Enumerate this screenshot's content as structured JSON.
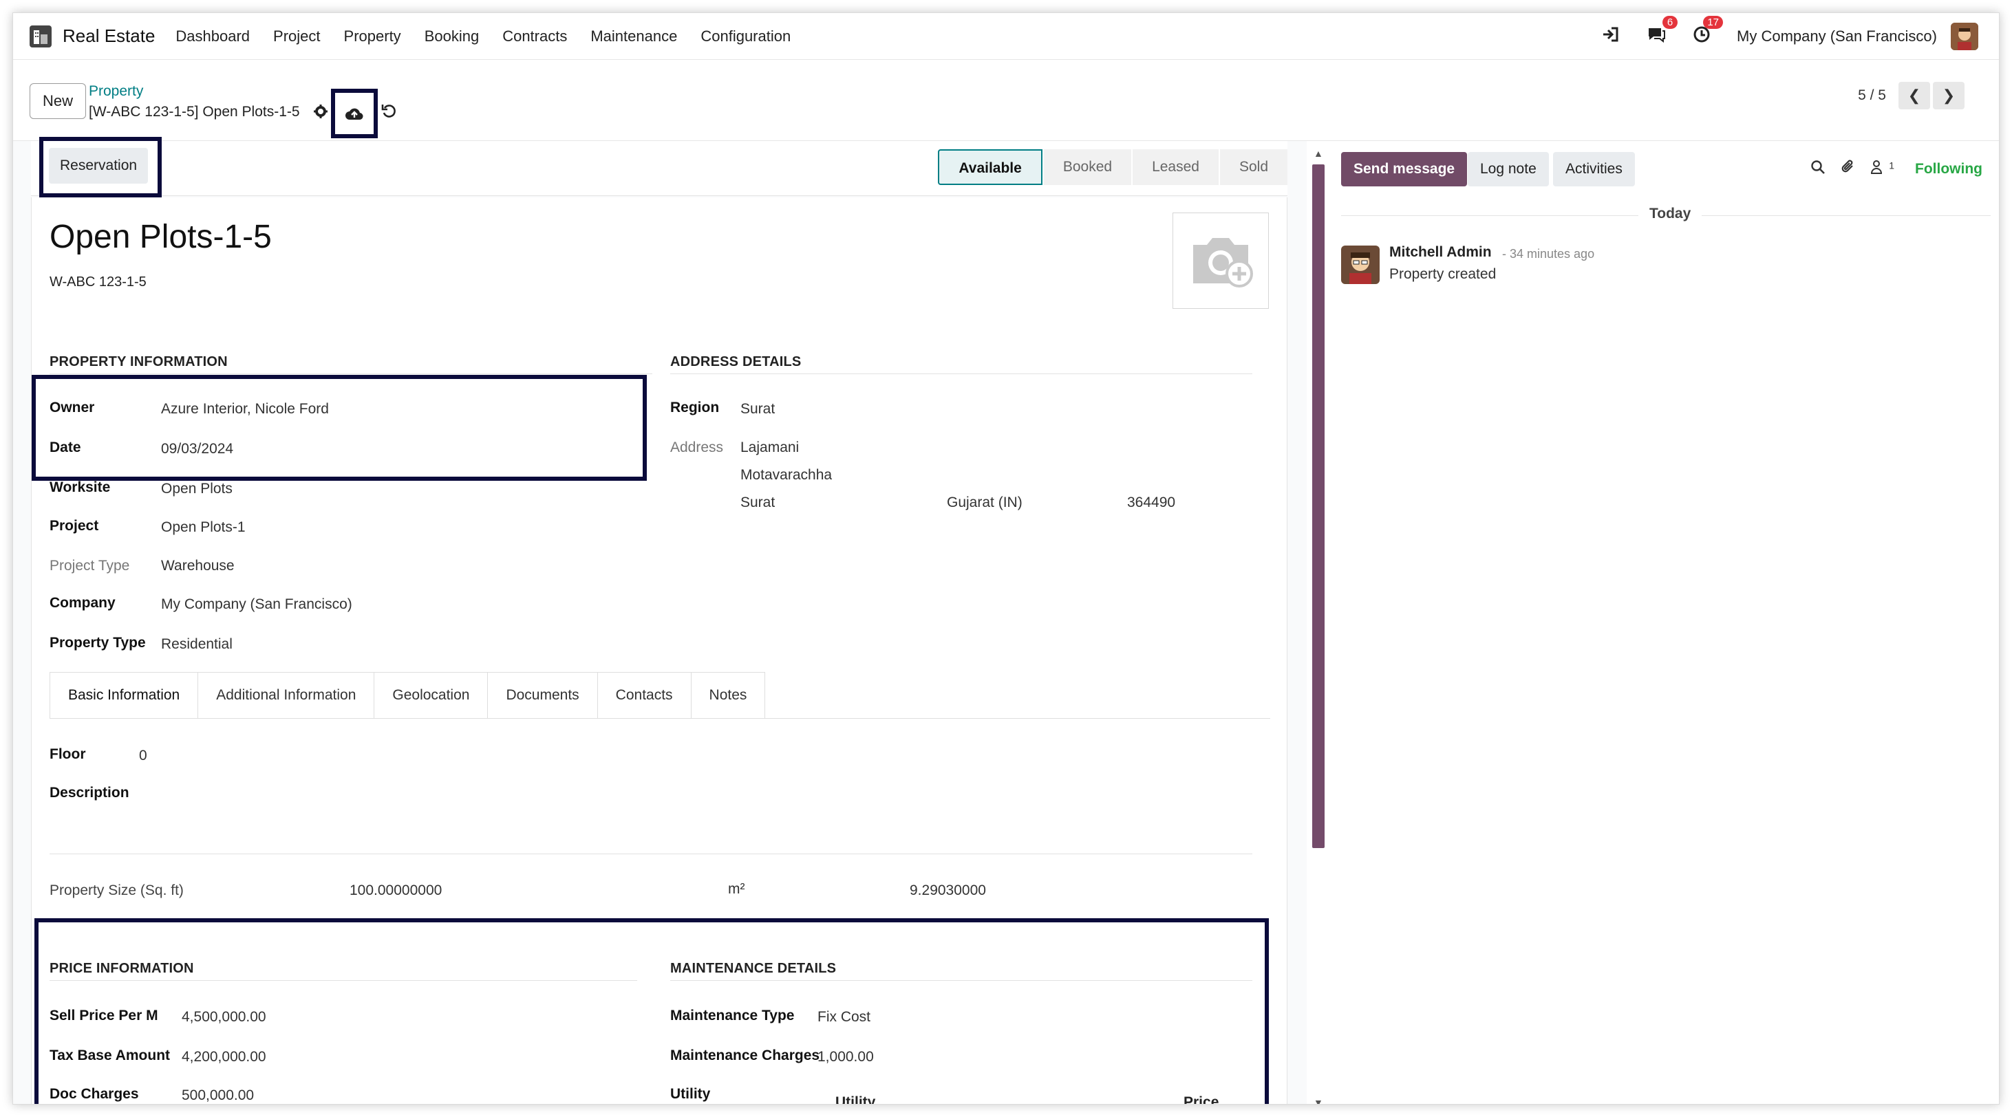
{
  "topnav": {
    "app_name": "Real Estate",
    "menu": [
      "Dashboard",
      "Project",
      "Property",
      "Booking",
      "Contracts",
      "Maintenance",
      "Configuration"
    ],
    "messages_badge": "6",
    "activities_badge": "17",
    "company": "My Company (San Francisco)"
  },
  "control": {
    "new_label": "New",
    "breadcrumb_parent": "Property",
    "breadcrumb_current": "[W-ABC 123-1-5] Open Plots-1-5",
    "pager": "5 / 5"
  },
  "statusbar": {
    "reservation_label": "Reservation",
    "stages": [
      "Available",
      "Booked",
      "Leased",
      "Sold"
    ],
    "active_stage": "Available"
  },
  "record": {
    "title": "Open Plots-1-5",
    "reference": "W-ABC 123-1-5"
  },
  "property_info": {
    "heading": "PROPERTY INFORMATION",
    "owner_label": "Owner",
    "owner": "Azure Interior, Nicole Ford",
    "date_label": "Date",
    "date": "09/03/2024",
    "worksite_label": "Worksite",
    "worksite": "Open Plots",
    "project_label": "Project",
    "project": "Open Plots-1",
    "project_type_label": "Project Type",
    "project_type": "Warehouse",
    "company_label": "Company",
    "company": "My Company (San Francisco)",
    "property_type_label": "Property Type",
    "property_type": "Residential"
  },
  "address": {
    "heading": "ADDRESS DETAILS",
    "region_label": "Region",
    "region": "Surat",
    "address_label": "Address",
    "street": "Lajamani",
    "street2": "Motavarachha",
    "city": "Surat",
    "state": "Gujarat (IN)",
    "zip": "364490"
  },
  "tabs": [
    "Basic Information",
    "Additional Information",
    "Geolocation",
    "Documents",
    "Contacts",
    "Notes"
  ],
  "basic": {
    "floor_label": "Floor",
    "floor": "0",
    "description_label": "Description",
    "size_label": "Property Size (Sq. ft)",
    "size": "100.00000000",
    "unit": "m²",
    "size_m2": "9.29030000"
  },
  "price": {
    "heading": "PRICE INFORMATION",
    "sell_label": "Sell Price Per M",
    "sell": "4,500,000.00",
    "tax_label": "Tax Base Amount",
    "tax": "4,200,000.00",
    "doc_label": "Doc Charges",
    "doc": "500,000.00"
  },
  "maintenance": {
    "heading": "MAINTENANCE DETAILS",
    "type_label": "Maintenance Type",
    "type": "Fix Cost",
    "charges_label": "Maintenance Charges",
    "charges": "1,000.00",
    "utility_label": "Utility",
    "col_utility": "Utility",
    "col_price": "Price"
  },
  "chatter": {
    "send_message": "Send message",
    "log_note": "Log note",
    "activities": "Activities",
    "followers_count": "1",
    "following": "Following",
    "today": "Today",
    "author": "Mitchell Admin",
    "time": "- 34 minutes ago",
    "body": "Property created"
  },
  "colors": {
    "accent": "#714b67",
    "link": "#017e84",
    "highlight": "#0b0b3b",
    "badge": "#e4343c"
  }
}
